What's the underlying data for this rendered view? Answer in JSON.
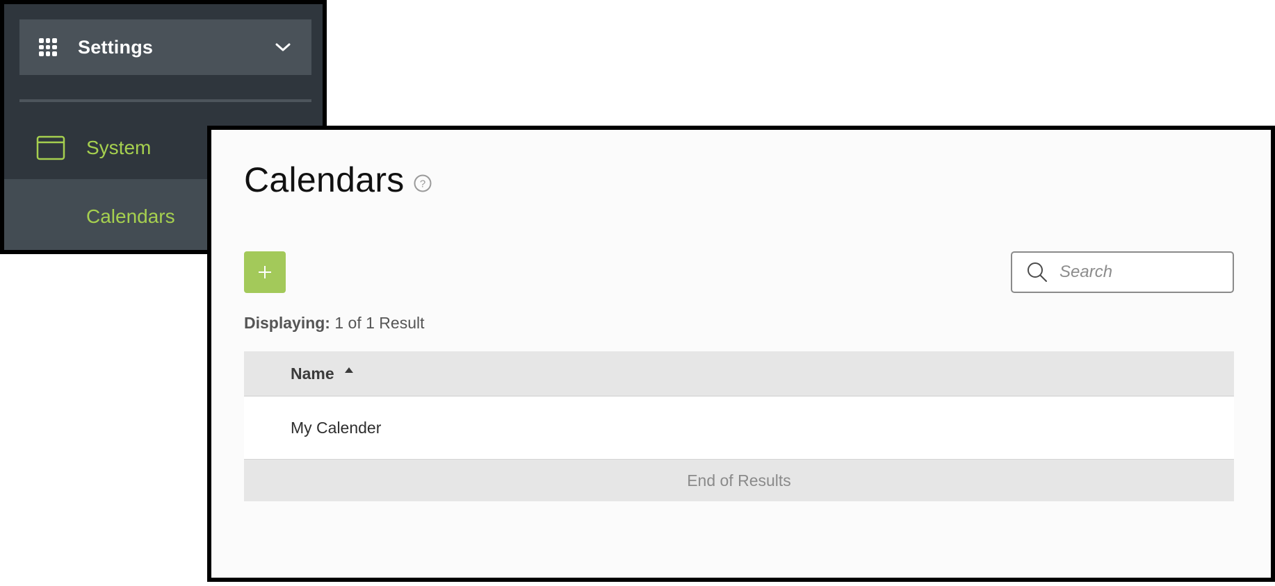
{
  "sidebar": {
    "header_title": "Settings",
    "header_icon": "apps-grid-icon",
    "header_chevron": "chevron-down-icon",
    "items": [
      {
        "label": "System",
        "icon": "window-icon"
      },
      {
        "label": "Calendars",
        "active": true
      }
    ],
    "colors": {
      "background": "#2f363d",
      "header_background": "#4a5259",
      "accent": "#a6d04f"
    }
  },
  "main": {
    "title": "Calendars",
    "help_icon": "help-circle-icon",
    "add_button_icon": "plus-icon",
    "search": {
      "placeholder": "Search",
      "value": ""
    },
    "result_count": {
      "label": "Displaying:",
      "value": "1 of 1 Result"
    },
    "table": {
      "columns": [
        {
          "label": "Name",
          "sort": "ascending"
        }
      ],
      "rows": [
        {
          "name": "My Calender"
        }
      ],
      "footer": "End of Results"
    },
    "colors": {
      "add_button": "#a3c95a",
      "table_header": "#e6e6e6"
    }
  }
}
